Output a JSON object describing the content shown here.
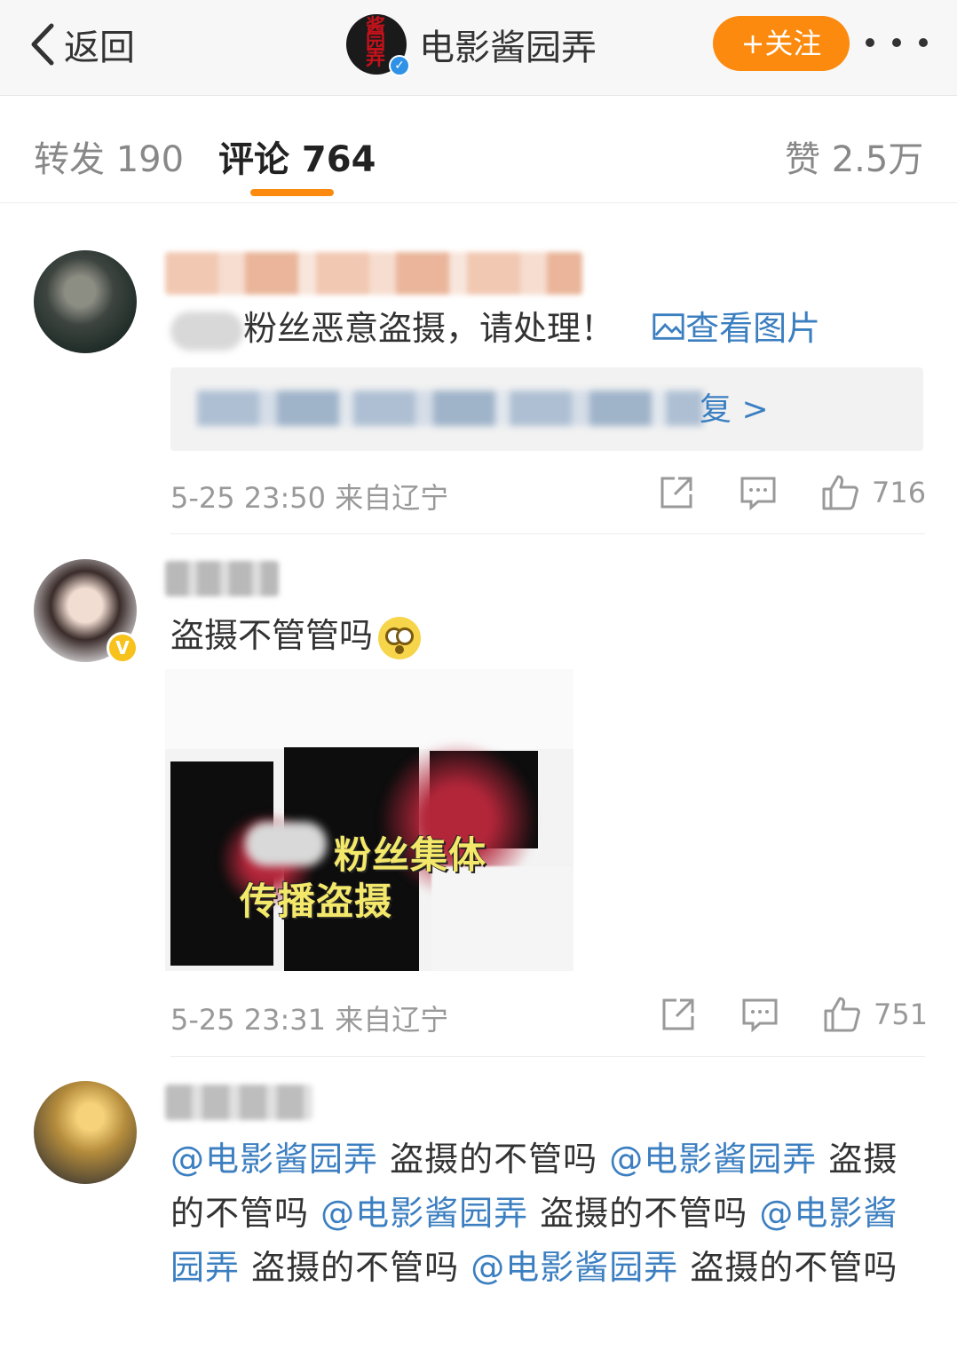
{
  "nav": {
    "back_label": "返回",
    "account_name": "电影酱园弄",
    "logo_text": "酱园弄",
    "follow_label": "+关注",
    "colors": {
      "accent": "#fb8a0e",
      "link": "#3c7fc1",
      "verified": "#2f92e6",
      "gold_v": "#f6c21b"
    }
  },
  "tabs": [
    {
      "label": "转发 190"
    },
    {
      "label": "评论 764"
    },
    {
      "label": "赞 2.5万"
    }
  ],
  "comments": [
    {
      "text": "粉丝恶意盗摄，请处理！",
      "view_image_label": "查看图片",
      "reply_more_label": "复 >",
      "time": "5-25 23:50 来自辽宁",
      "likes": "716"
    },
    {
      "text": "盗摄不管管吗",
      "image_caption_line1": "粉丝集体",
      "image_caption_line2": "传播盗摄",
      "time": "5-25 23:31 来自辽宁",
      "likes": "751",
      "verified_badge": "V"
    },
    {
      "mention": "@电影酱园弄",
      "phrase": "盗摄的不管吗"
    }
  ]
}
